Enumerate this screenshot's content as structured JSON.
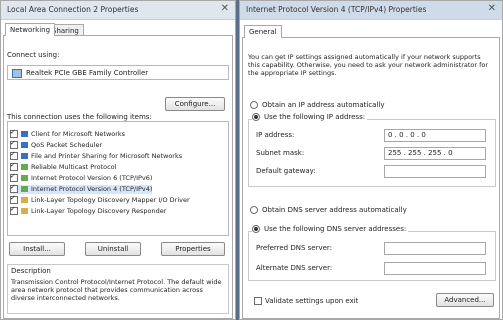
{
  "left": {
    "title": "Local Area Connection 2 Properties",
    "tabs": [
      "Networking",
      "Sharing"
    ],
    "connect_using_label": "Connect using:",
    "adapter_name": "Realtek PCIe GBE Family Controller",
    "configure_label": "Configure...",
    "items_label": "This connection uses the following items:",
    "items": [
      {
        "label": "Client for Microsoft Networks",
        "checked": true
      },
      {
        "label": "QoS Packet Scheduler",
        "checked": true
      },
      {
        "label": "File and Printer Sharing for Microsoft Networks",
        "checked": true
      },
      {
        "label": "Reliable Multicast Protocol",
        "checked": true
      },
      {
        "label": "Internet Protocol Version 6 (TCP/IPv6)",
        "checked": true
      },
      {
        "label": "Internet Protocol Version 4 (TCP/IPv4)",
        "checked": true,
        "selected": true
      },
      {
        "label": "Link-Layer Topology Discovery Mapper I/O Driver",
        "checked": true
      },
      {
        "label": "Link-Layer Topology Discovery Responder",
        "checked": true
      }
    ],
    "install_label": "Install...",
    "uninstall_label": "Uninstall",
    "properties_label": "Properties",
    "description_title": "Description",
    "description_text": "Transmission Control Protocol/Internet Protocol. The default wide area network protocol that provides communication across diverse interconnected networks."
  },
  "right": {
    "title": "Internet Protocol Version 4 (TCP/IPv4) Properties",
    "tab": "General",
    "intro": "You can get IP settings assigned automatically if your network supports this capability. Otherwise, you need to ask your network administrator for the appropriate IP settings.",
    "obtain_ip_auto": "Obtain an IP address automatically",
    "use_following_ip": "Use the following IP address:",
    "ip_address_label": "IP address:",
    "ip_address_value": "0 . 0 . 0 . 0",
    "subnet_label": "Subnet mask:",
    "subnet_value": "255 . 255 . 255 . 0",
    "gateway_label": "Default gateway:",
    "gateway_value": "",
    "obtain_dns_auto": "Obtain DNS server address automatically",
    "use_following_dns": "Use the following DNS server addresses:",
    "preferred_dns_label": "Preferred DNS server:",
    "alternate_dns_label": "Alternate DNS server:",
    "validate_label": "Validate settings upon exit",
    "advanced_label": "Advanced..."
  },
  "colors": {
    "accent": "#3a70c0",
    "selection": "#d7e6fa"
  }
}
